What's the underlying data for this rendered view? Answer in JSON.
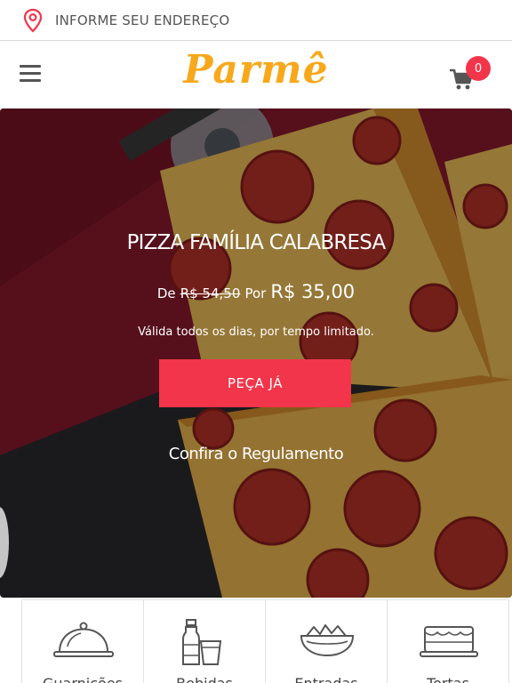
{
  "address_bar": {
    "label": "INFORME SEU ENDEREÇO",
    "icon": "location-pin-icon"
  },
  "header": {
    "logo_text": "Parmê",
    "cart_count": "0",
    "brand_color": "#f7a81b",
    "accent_color": "#f2354a"
  },
  "hero": {
    "title": "PIZZA FAMÍLIA CALABRESA",
    "price_prefix": "De",
    "old_price": "R$ 54,50",
    "price_connector": "Por",
    "new_price": "R$ 35,00",
    "note": "Válida todos os dias, por tempo limitado.",
    "button_label": "PEÇA JÁ",
    "rules_link": "Confira o Regulamento"
  },
  "categories": [
    {
      "label": "Guarnições",
      "icon": "cloche-icon"
    },
    {
      "label": "Bebidas",
      "icon": "drinks-icon"
    },
    {
      "label": "Entradas",
      "icon": "salad-bowl-icon"
    },
    {
      "label": "Tortas",
      "icon": "cake-icon"
    }
  ]
}
